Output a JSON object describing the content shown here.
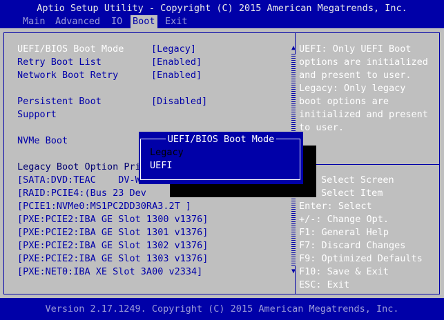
{
  "title": "Aptio Setup Utility - Copyright (C) 2015 American Megatrends, Inc.",
  "menu": [
    "Main",
    "Advanced",
    "IO",
    "Boot",
    "Exit"
  ],
  "settings": [
    {
      "label": "UEFI/BIOS Boot Mode",
      "value": "[Legacy]"
    },
    {
      "label": "Retry Boot List",
      "value": "[Enabled]"
    },
    {
      "label": "Network Boot Retry",
      "value": "[Enabled]"
    },
    {
      "label": "Persistent Boot",
      "label2": "Support",
      "value": "[Disabled]"
    },
    {
      "label": "NVMe Boot",
      "value": ""
    }
  ],
  "legacy_priority_label": "Legacy Boot Option Pri",
  "boot_options": [
    "[SATA:DVD:TEAC    DV-W",
    "[RAID:PCIE4:(Bus 23 Dev",
    "[PCIE1:NVMe0:MS1PC2DD30RA3.2T ]",
    "[PXE:PCIE2:IBA GE Slot 1300 v1376]",
    "[PXE:PCIE2:IBA GE Slot 1301 v1376]",
    "[PXE:PCIE2:IBA GE Slot 1302 v1376]",
    "[PXE:PCIE2:IBA GE Slot 1303 v1376]",
    "[PXE:NET0:IBA XE Slot 3A00 v2334]"
  ],
  "help_text": [
    "UEFI: Only UEFI Boot",
    "options are initialized",
    "and present to user.",
    "Legacy: Only legacy",
    "boot options are",
    "initialized and present",
    "to user."
  ],
  "key_help": [
    "Select Screen",
    "Select Item",
    "Enter: Select",
    "+/-: Change Opt.",
    "F1: General Help",
    "F7: Discard Changes",
    "F9: Optimized Defaults",
    "F10: Save & Exit",
    "ESC: Exit"
  ],
  "popup": {
    "title": "UEFI/BIOS Boot Mode",
    "options": [
      "Legacy",
      "UEFI"
    ]
  },
  "footer": "Version 2.17.1249. Copyright (C) 2015 American Megatrends, Inc.",
  "colors": {
    "background": "#0000a8",
    "panel": "#bfbfbf",
    "highlight_text": "#ffffff"
  }
}
